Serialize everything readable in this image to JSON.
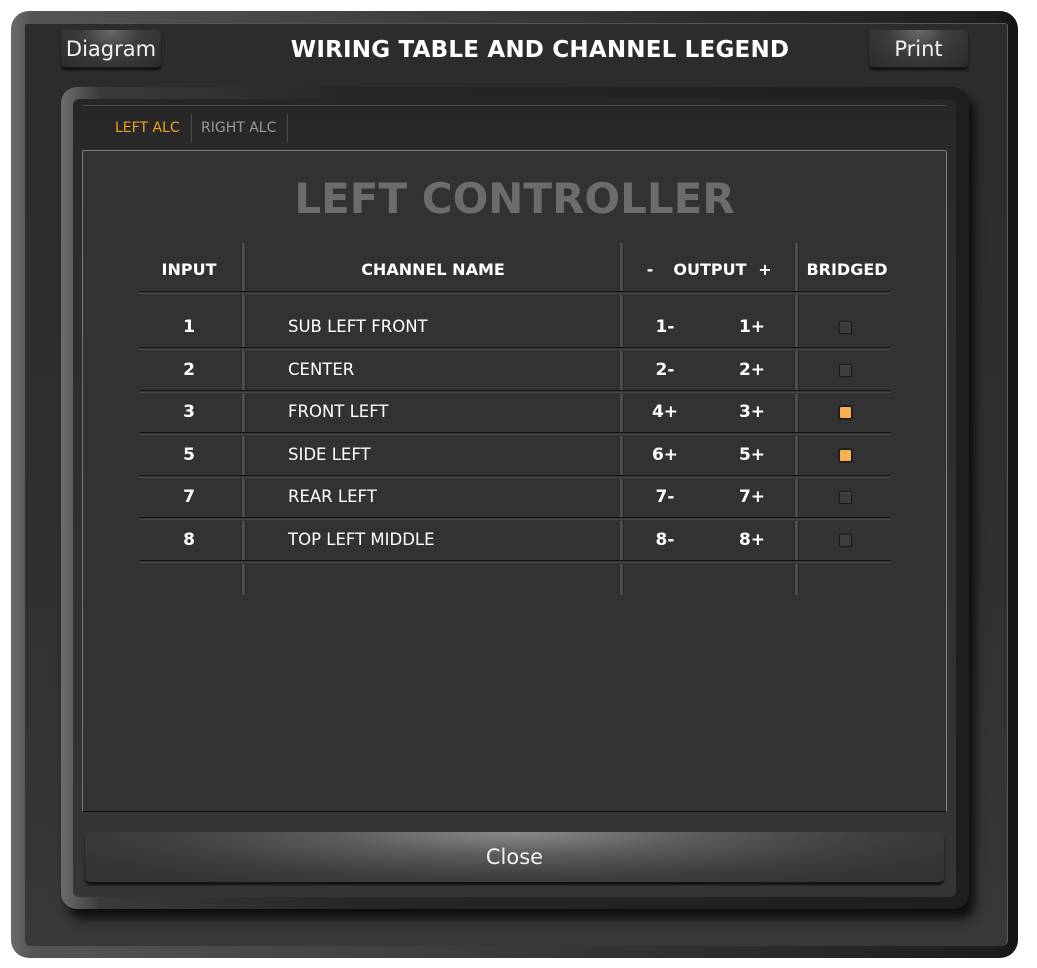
{
  "header": {
    "title": "WIRING TABLE AND CHANNEL LEGEND",
    "diagram_label": "Diagram",
    "print_label": "Print"
  },
  "tabs": [
    {
      "label": "LEFT ALC",
      "active": true
    },
    {
      "label": "RIGHT ALC",
      "active": false
    }
  ],
  "panel": {
    "title": "LEFT CONTROLLER",
    "columns": {
      "input": "INPUT",
      "channel_name": "CHANNEL NAME",
      "output_minus": "-",
      "output": "OUTPUT",
      "output_plus": "+",
      "bridged": "BRIDGED"
    },
    "rows": [
      {
        "input": "1",
        "name": "SUB LEFT FRONT",
        "out_neg": "1-",
        "out_pos": "1+",
        "bridged": false
      },
      {
        "input": "2",
        "name": "CENTER",
        "out_neg": "2-",
        "out_pos": "2+",
        "bridged": false
      },
      {
        "input": "3",
        "name": "FRONT LEFT",
        "out_neg": "4+",
        "out_pos": "3+",
        "bridged": true
      },
      {
        "input": "5",
        "name": "SIDE LEFT",
        "out_neg": "6+",
        "out_pos": "5+",
        "bridged": true
      },
      {
        "input": "7",
        "name": "REAR LEFT",
        "out_neg": "7-",
        "out_pos": "7+",
        "bridged": false
      },
      {
        "input": "8",
        "name": "TOP LEFT MIDDLE",
        "out_neg": "8-",
        "out_pos": "8+",
        "bridged": false
      }
    ]
  },
  "footer": {
    "close_label": "Close"
  },
  "colors": {
    "active_tab": "#f0a020",
    "inactive_tab": "#9a9a9a",
    "bridged_on": "#f8b050",
    "heading_gray": "#6c6c6c"
  }
}
